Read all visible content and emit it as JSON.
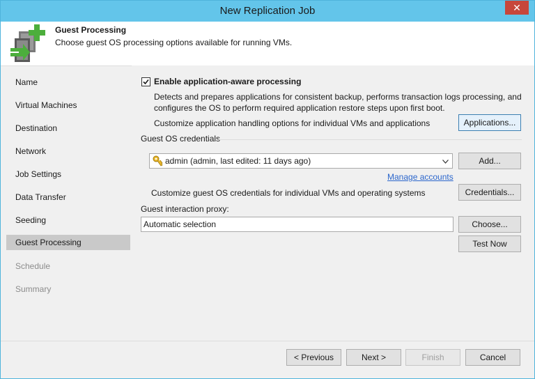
{
  "window": {
    "title": "New Replication Job",
    "close_glyph": "✕"
  },
  "header": {
    "title": "Guest Processing",
    "subtitle": "Choose guest OS processing options available for running VMs.",
    "icon": "replication-job-icon"
  },
  "sidebar": {
    "items": [
      {
        "label": "Name",
        "state": "normal"
      },
      {
        "label": "Virtual Machines",
        "state": "normal"
      },
      {
        "label": "Destination",
        "state": "normal"
      },
      {
        "label": "Network",
        "state": "normal"
      },
      {
        "label": "Job Settings",
        "state": "normal"
      },
      {
        "label": "Data Transfer",
        "state": "normal"
      },
      {
        "label": "Seeding",
        "state": "normal"
      },
      {
        "label": "Guest Processing",
        "state": "active"
      },
      {
        "label": "Schedule",
        "state": "disabled"
      },
      {
        "label": "Summary",
        "state": "disabled"
      }
    ]
  },
  "main": {
    "app_aware": {
      "checked": true,
      "label": "Enable application-aware processing",
      "description_line1": "Detects and prepares applications for consistent backup, performs transaction logs processing, and",
      "description_line2": "configures the OS to perform required application restore steps upon first boot.",
      "customize_text": "Customize application handling options for individual VMs and applications",
      "applications_button": "Applications..."
    },
    "credentials": {
      "group_label": "Guest OS credentials",
      "selected_value": "admin (admin, last edited: 11 days ago)",
      "add_button": "Add...",
      "manage_link": "Manage accounts",
      "customize_text": "Customize guest OS credentials for individual VMs and operating systems",
      "credentials_button": "Credentials..."
    },
    "proxy": {
      "label": "Guest interaction proxy:",
      "value": "Automatic selection",
      "choose_button": "Choose...",
      "test_button": "Test Now"
    }
  },
  "footer": {
    "previous": "< Previous",
    "next": "Next >",
    "finish": "Finish",
    "cancel": "Cancel"
  }
}
